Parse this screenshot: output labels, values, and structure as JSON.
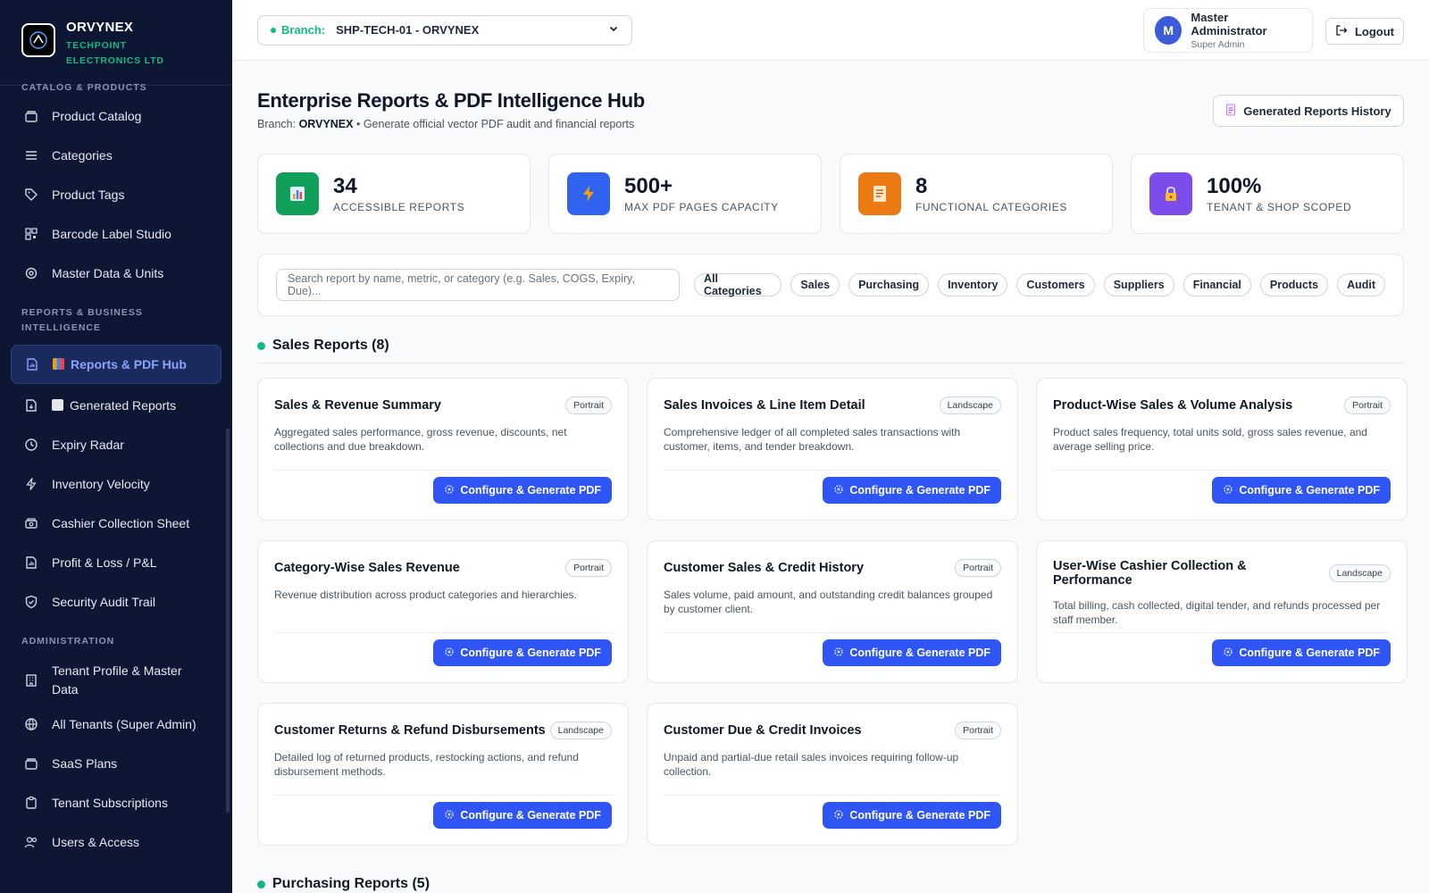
{
  "brand": {
    "name": "ORVYNEX",
    "subtitle": "TECHPOINT ELECTRONICS LTD"
  },
  "sidebar": {
    "sections": {
      "catalog": "CATALOG & PRODUCTS",
      "reports": "REPORTS & BUSINESS INTELLIGENCE",
      "admin": "ADMINISTRATION"
    },
    "items": {
      "product_catalog": "Product Catalog",
      "categories": "Categories",
      "product_tags": "Product Tags",
      "barcode": "Barcode Label Studio",
      "master_data": "Master Data & Units",
      "reports_hub": "Reports & PDF Hub",
      "generated_reports": "Generated Reports",
      "expiry": "Expiry Radar",
      "velocity": "Inventory Velocity",
      "cashier": "Cashier Collection Sheet",
      "pnl": "Profit & Loss / P&L",
      "audit": "Security Audit Trail",
      "tenant_profile": "Tenant Profile & Master Data",
      "all_tenants": "All Tenants (Super Admin)",
      "saas": "SaaS Plans",
      "subscriptions": "Tenant Subscriptions",
      "users": "Users & Access"
    }
  },
  "topbar": {
    "branch_label": "Branch:",
    "branch_value": "SHP-TECH-01 - ORVYNEX",
    "user_initial": "M",
    "user_name": "Master Administrator",
    "user_role": "Super Admin",
    "logout": "Logout"
  },
  "page": {
    "title": "Enterprise Reports & PDF Intelligence Hub",
    "sub_prefix": "Branch:",
    "sub_branch": "ORVYNEX",
    "sub_rest": "• Generate official vector PDF audit and financial reports",
    "history_btn": "Generated Reports History"
  },
  "stats": [
    {
      "value": "34",
      "label": "ACCESSIBLE REPORTS"
    },
    {
      "value": "500+",
      "label": "MAX PDF PAGES CAPACITY"
    },
    {
      "value": "8",
      "label": "FUNCTIONAL CATEGORIES"
    },
    {
      "value": "100%",
      "label": "TENANT & SHOP SCOPED"
    }
  ],
  "filters": {
    "search_placeholder": "Search report by name, metric, or category (e.g. Sales, COGS, Expiry, Due)...",
    "chips": [
      "All Categories",
      "Sales",
      "Purchasing",
      "Inventory",
      "Customers",
      "Suppliers",
      "Financial",
      "Products",
      "Audit"
    ]
  },
  "sales_section": "Sales Reports (8)",
  "generate_label": "Configure & Generate PDF",
  "cards": [
    {
      "title": "Sales & Revenue Summary",
      "orientation": "Portrait",
      "desc": "Aggregated sales performance, gross revenue, discounts, net collections and due breakdown."
    },
    {
      "title": "Sales Invoices & Line Item Detail",
      "orientation": "Landscape",
      "desc": "Comprehensive ledger of all completed sales transactions with customer, items, and tender breakdown."
    },
    {
      "title": "Product-Wise Sales & Volume Analysis",
      "orientation": "Portrait",
      "desc": "Product sales frequency, total units sold, gross sales revenue, and average selling price."
    },
    {
      "title": "Category-Wise Sales Revenue",
      "orientation": "Portrait",
      "desc": "Revenue distribution across product categories and hierarchies."
    },
    {
      "title": "Customer Sales & Credit History",
      "orientation": "Portrait",
      "desc": "Sales volume, paid amount, and outstanding credit balances grouped by customer client."
    },
    {
      "title": "User-Wise Cashier Collection & Performance",
      "orientation": "Landscape",
      "desc": "Total billing, cash collected, digital tender, and refunds processed per staff member."
    },
    {
      "title": "Customer Returns & Refund Disbursements",
      "orientation": "Landscape",
      "desc": "Detailed log of returned products, restocking actions, and refund disbursement methods."
    },
    {
      "title": "Customer Due & Credit Invoices",
      "orientation": "Portrait",
      "desc": "Unpaid and partial-due retail sales invoices requiring follow-up collection."
    }
  ],
  "next_section": "Purchasing Reports (5)",
  "colors": {
    "accent": "#2f55f4",
    "sidebar": "#0d1733",
    "success": "#10b981"
  }
}
